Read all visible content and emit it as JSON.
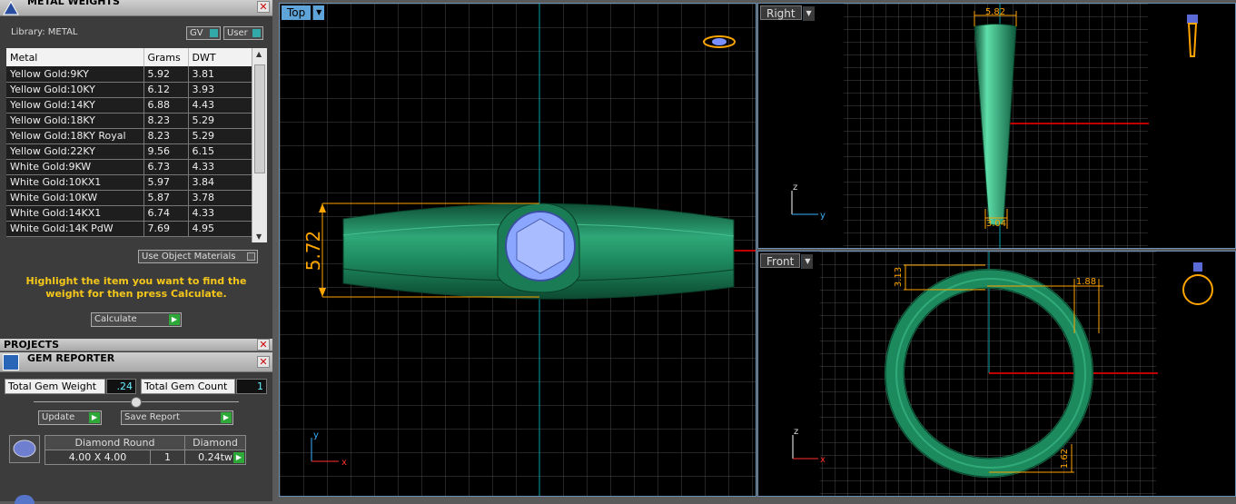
{
  "metal_weights": {
    "title": "METAL WEIGHTS",
    "library_label": "Library: METAL",
    "gv_label": "GV",
    "user_label": "User",
    "columns": [
      "Metal",
      "Grams",
      "DWT"
    ],
    "rows": [
      [
        "Yellow Gold:9KY",
        "5.92",
        "3.81"
      ],
      [
        "Yellow Gold:10KY",
        "6.12",
        "3.93"
      ],
      [
        "Yellow Gold:14KY",
        "6.88",
        "4.43"
      ],
      [
        "Yellow Gold:18KY",
        "8.23",
        "5.29"
      ],
      [
        "Yellow Gold:18KY Royal",
        "8.23",
        "5.29"
      ],
      [
        "Yellow Gold:22KY",
        "9.56",
        "6.15"
      ],
      [
        "White Gold:9KW",
        "6.73",
        "4.33"
      ],
      [
        "White Gold:10KX1",
        "5.97",
        "3.84"
      ],
      [
        "White Gold:10KW",
        "5.87",
        "3.78"
      ],
      [
        "White Gold:14KX1",
        "6.74",
        "4.33"
      ],
      [
        "White Gold:14K PdW",
        "7.69",
        "4.95"
      ]
    ],
    "use_object_materials": "Use Object Materials",
    "hint": "Highlight the item you want to find the weight for then press Calculate.",
    "calculate_label": "Calculate"
  },
  "projects": {
    "title": "PROJECTS"
  },
  "gem_reporter": {
    "title": "GEM REPORTER",
    "total_weight_label": "Total Gem Weight",
    "total_weight_value": ".24",
    "total_count_label": "Total Gem Count",
    "total_count_value": "1",
    "update_label": "Update",
    "save_report_label": "Save Report",
    "gem": {
      "name": "Diamond Round",
      "size": "4.00 X 4.00",
      "material": "Diamond",
      "count": "1",
      "weight": "0.24tw"
    }
  },
  "viewports": {
    "top": {
      "label": "Top",
      "dimension": "5.72"
    },
    "right": {
      "label": "Right",
      "dim_top": "5.82",
      "dim_bottom": "3.04"
    },
    "front": {
      "label": "Front",
      "dim_left": "3.13",
      "dim_right": "1.88",
      "dim_bottom": "1.62"
    }
  },
  "colors": {
    "ring": "#1f8a5e",
    "dimension": "#ffa500",
    "axis_cyan": "#00a0a8",
    "axis_red": "#c00000",
    "gem": "#8aa6ff"
  }
}
